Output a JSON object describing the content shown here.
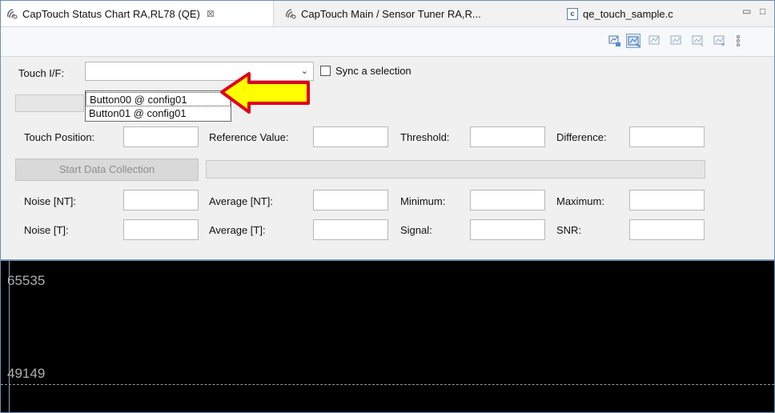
{
  "tabs": [
    {
      "label": "CapTouch Status Chart RA,RL78 (QE)",
      "close": "⊠",
      "active": true,
      "icon": "captouch-icon"
    },
    {
      "label": "CapTouch Main / Sensor Tuner RA,R...",
      "active": false,
      "icon": "captouch-icon"
    },
    {
      "label": "qe_touch_sample.c",
      "active": false,
      "icon": "c-file-icon",
      "file_badge": "c"
    }
  ],
  "window_controls": {
    "minimize": "▭",
    "maximize": "□"
  },
  "form": {
    "touch_if_label": "Touch I/F:",
    "touch_if_value": "",
    "sync_label": "Sync a selection",
    "sync_checked": false,
    "dropdown_options": [
      "Button00 @ config01",
      "Button01 @ config01"
    ],
    "row1": {
      "touch_position": "Touch Position:",
      "reference_value": "Reference Value:",
      "threshold": "Threshold:",
      "difference": "Difference:"
    },
    "start_button": "Start Data Collection",
    "row3": {
      "noise_nt": "Noise [NT]:",
      "average_nt": "Average [NT]:",
      "minimum": "Minimum:",
      "maximum": "Maximum:"
    },
    "row4": {
      "noise_t": "Noise [T]:",
      "average_t": "Average [T]:",
      "signal": "Signal:",
      "snr": "SNR:"
    }
  },
  "chart": {
    "y_ticks": [
      "65535",
      "49149"
    ]
  },
  "annotation": {
    "color": "#ffff00",
    "border": "#e0001b"
  }
}
